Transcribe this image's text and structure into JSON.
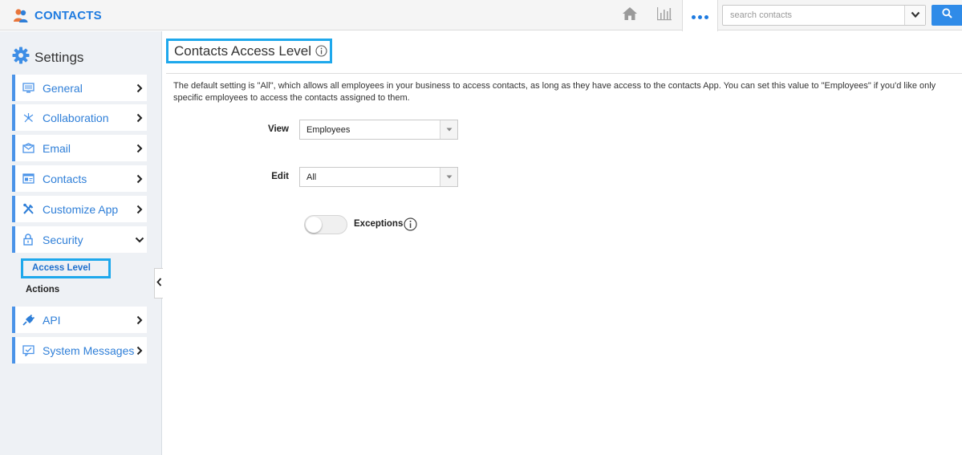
{
  "app": {
    "title": "CONTACTS",
    "brand_color": "#1e7be0"
  },
  "topbar": {
    "icons": [
      "home-icon",
      "chart-icon",
      "more-icon"
    ],
    "search": {
      "placeholder": "search contacts",
      "value": ""
    }
  },
  "sidebar": {
    "title": "Settings",
    "items": [
      {
        "label": "General",
        "icon": "monitor-icon"
      },
      {
        "label": "Collaboration",
        "icon": "collaboration-icon"
      },
      {
        "label": "Email",
        "icon": "envelope-icon"
      },
      {
        "label": "Contacts",
        "icon": "contact-card-icon"
      },
      {
        "label": "Customize App",
        "icon": "tools-icon"
      },
      {
        "label": "Security",
        "icon": "lock-icon",
        "expanded": true
      },
      {
        "label": "API",
        "icon": "plug-icon"
      },
      {
        "label": "System Messages",
        "icon": "message-icon"
      }
    ],
    "security_sub": {
      "active": "Access Level",
      "other": "Actions"
    }
  },
  "main": {
    "title": "Contacts Access Level",
    "description": "The default setting is \"All\", which allows all employees in your business to access contacts, as long as they have access to the contacts App. You can set this value to \"Employees\" if you'd like only specific employees to access the contacts assigned to them.",
    "view": {
      "label": "View",
      "value": "Employees"
    },
    "edit": {
      "label": "Edit",
      "value": "All"
    },
    "exceptions": {
      "label": "Exceptions",
      "enabled": false
    }
  },
  "colors": {
    "accent": "#1e7be0",
    "highlight_border": "#1ea8ec",
    "sidebar_bg": "#eef1f5"
  }
}
